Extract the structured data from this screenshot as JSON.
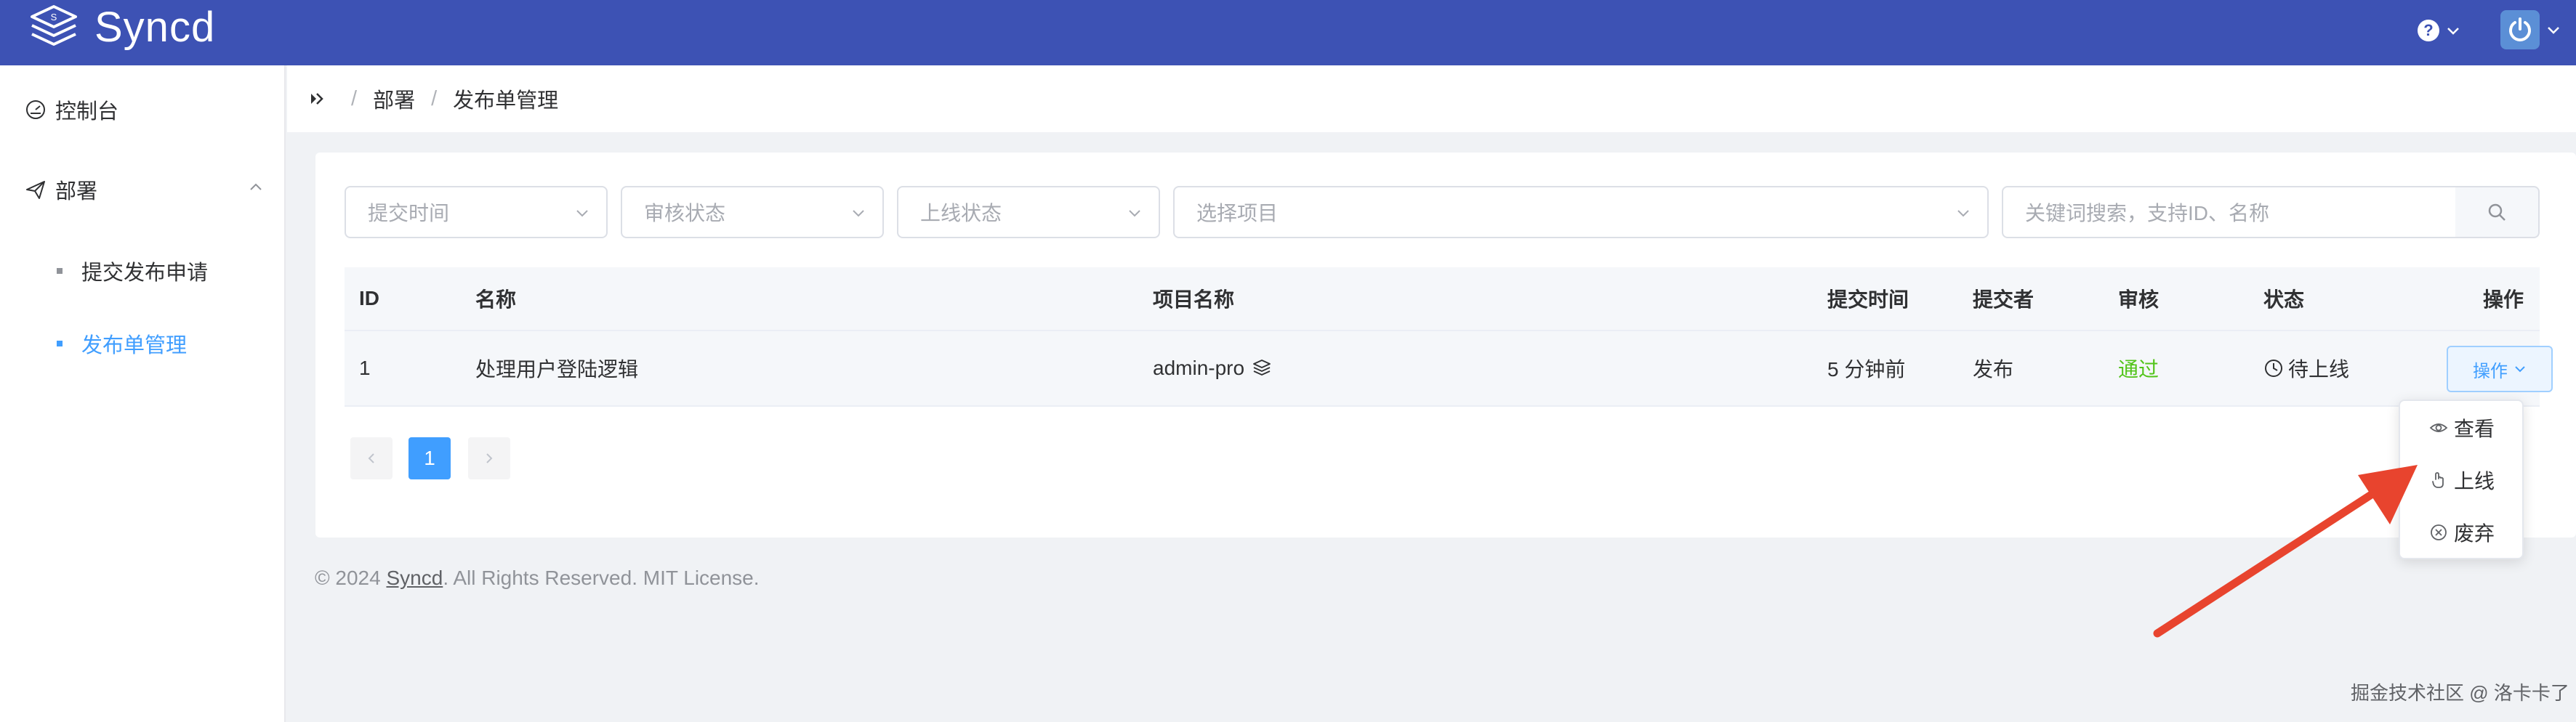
{
  "app": {
    "brand": "Syncd"
  },
  "header": {
    "help_icon": "question-circle-icon",
    "avatar_icon": "power-icon"
  },
  "sidebar": {
    "items": [
      {
        "label": "控制台",
        "icon": "dashboard-gauge-icon"
      },
      {
        "label": "部署",
        "icon": "send-plane-icon",
        "expanded": true,
        "children": [
          {
            "label": "提交发布申请",
            "active": false
          },
          {
            "label": "发布单管理",
            "active": true
          }
        ]
      }
    ]
  },
  "breadcrumb": {
    "items": [
      "部署",
      "发布单管理"
    ]
  },
  "filters": {
    "submit_time_placeholder": "提交时间",
    "review_status_placeholder": "审核状态",
    "online_status_placeholder": "上线状态",
    "project_placeholder": "选择项目",
    "search_placeholder": "关键词搜索，支持ID、名称"
  },
  "table": {
    "columns": [
      "ID",
      "名称",
      "项目名称",
      "提交时间",
      "提交者",
      "审核",
      "状态",
      "操作"
    ],
    "rows": [
      {
        "id": "1",
        "name": "处理用户登陆逻辑",
        "project": "admin-pro",
        "time": "5 分钟前",
        "submitter": "发布",
        "review": "通过",
        "status": "待上线",
        "action": "操作"
      }
    ]
  },
  "pagination": {
    "current": "1"
  },
  "action_menu": {
    "items": [
      "查看",
      "上线",
      "废弃"
    ]
  },
  "footer": {
    "prefix": "© 2024 ",
    "link": "Syncd",
    "suffix": ". All Rights Reserved. MIT License."
  },
  "watermark": "掘金技术社区 @ 洛卡卡了",
  "colors": {
    "header": "#3d52b4",
    "accent": "#409eff",
    "success": "#52c41a",
    "annotation_arrow": "#e8442e"
  }
}
